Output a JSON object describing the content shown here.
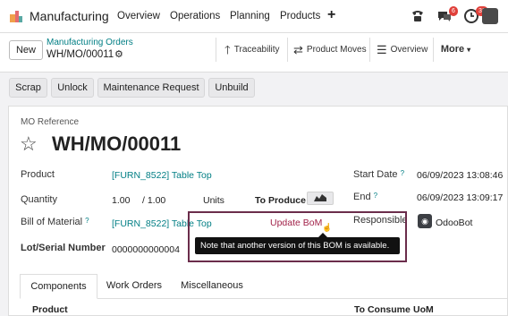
{
  "app": {
    "name": "Manufacturing"
  },
  "menu": [
    "Overview",
    "Operations",
    "Planning",
    "Products"
  ],
  "badges": {
    "messages": "6",
    "activities": "36"
  },
  "colors": {
    "accent": "#017e84",
    "highlight": "#6b2d4b",
    "warning_link": "#a2234a",
    "badge": "#e0403a"
  },
  "control": {
    "new_label": "New",
    "breadcrumb": "Manufacturing Orders",
    "record": "WH/MO/00011"
  },
  "smart_buttons": [
    {
      "icon": "arrow-up-icon",
      "label": "Traceability"
    },
    {
      "icon": "swap-arrows-icon",
      "label": "Product Moves"
    },
    {
      "icon": "list-icon",
      "label": "Overview"
    }
  ],
  "more_label": "More",
  "actions": [
    "Scrap",
    "Unlock",
    "Maintenance Request",
    "Unbuild"
  ],
  "form": {
    "mo_ref_label": "MO Reference",
    "mo_name": "WH/MO/00011",
    "product_label": "Product",
    "product_value": "[FURN_8522] Table Top",
    "quantity_label": "Quantity",
    "quantity_value": "1.00",
    "quantity_total": "/ 1.00",
    "quantity_unit": "Units",
    "to_produce": "To Produce",
    "bom_label": "Bill of Material",
    "bom_value": "[FURN_8522] Table Top",
    "update_bom": "Update BoM",
    "lot_label": "Lot/Serial Number",
    "lot_value": "0000000000004",
    "start_label": "Start Date",
    "start_value": "06/09/2023 13:08:46",
    "end_label": "End",
    "end_value": "06/09/2023 13:09:17",
    "responsible_label": "Responsible",
    "responsible_value": "OdooBot"
  },
  "tooltip": "Note that another version of this BOM is available.",
  "tabs": [
    "Components",
    "Work Orders",
    "Miscellaneous"
  ],
  "columns": {
    "product": "Product",
    "to_consume": "To Consume",
    "uom": "UoM"
  }
}
